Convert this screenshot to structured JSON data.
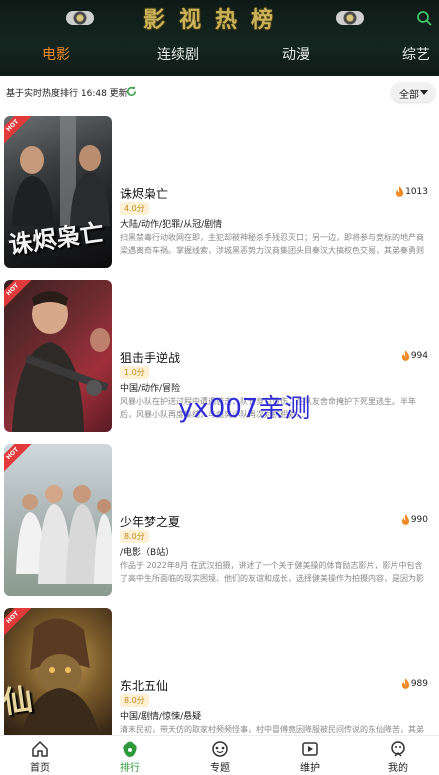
{
  "header": {
    "brand_title": "影视热榜",
    "tabs": [
      {
        "label": "电影",
        "active": true
      },
      {
        "label": "连续剧",
        "active": false
      },
      {
        "label": "动漫",
        "active": false
      },
      {
        "label": "综艺",
        "active": false
      }
    ]
  },
  "infobar": {
    "update_text": "基于实时热度排行 16:48 更新",
    "filter_label": "全部"
  },
  "items": [
    {
      "title": "诛烬枭亡",
      "heat": "1013",
      "score": "4.0分",
      "tags": "大陆/动作/犯罪/从冠/剧情",
      "desc": "扫黑禁毒行动收网在即，主犯却被神秘杀手残忍灭口；另一边，即将参与竞标的地产商梁遇离奇车祸。掌握线索，涉城黑恶势力汉商集团头目秦汉大搞权色交易，其弟秦勇则在暗处杀人…",
      "poster_caption": "诛烬枭亡",
      "hot_badge": "HOT"
    },
    {
      "title": "狙击手逆战",
      "heat": "994",
      "score": "1.0分",
      "tags": "中国/动作/冒险",
      "desc": "风暴小队在护送过程中遭遇袭击，队长身负重伤，在队友舍命掩护下死里逃生。半年后，风暴小队再度集结，与曲奕小队再次对抗相对…",
      "poster_caption": "",
      "hot_badge": "HOT"
    },
    {
      "title": "少年梦之夏",
      "heat": "990",
      "score": "8.0分",
      "tags": "/电影（B站）",
      "desc": "作品于 2022年8月 在武汉拍摄，讲述了一个关于健美操的体育励志影片，影片中包含了高中生所面临的现实困境、他们的友谊和成长，选择健美操作为拍摄内容，是因为影片中大部分…",
      "poster_caption": "",
      "hot_badge": "HOT"
    },
    {
      "title": "东北五仙",
      "heat": "989",
      "score": "8.0分",
      "tags": "中国/剧情/惊悚/悬疑",
      "desc": "清末民初，带天仿的取家村频频怪事，村中冒傅竟因降服被民间传说的东仙降苦，其弟子那笙…",
      "poster_caption": "仙",
      "hot_badge": "HOT"
    }
  ],
  "watermark": "yx007亲测",
  "bottom_nav": [
    {
      "label": "首页",
      "icon": "home-icon",
      "active": false
    },
    {
      "label": "排行",
      "icon": "ranking-icon",
      "active": true
    },
    {
      "label": "专题",
      "icon": "topic-icon",
      "active": false
    },
    {
      "label": "维护",
      "icon": "maintenance-icon",
      "active": false
    },
    {
      "label": "我的",
      "icon": "profile-icon",
      "active": false
    }
  ],
  "colors": {
    "accent_orange": "#f08a24",
    "active_green": "#2e9a3a",
    "header_bg": "#13221d",
    "score_text": "#c58a1a",
    "watermark": "#2f2bd6"
  }
}
